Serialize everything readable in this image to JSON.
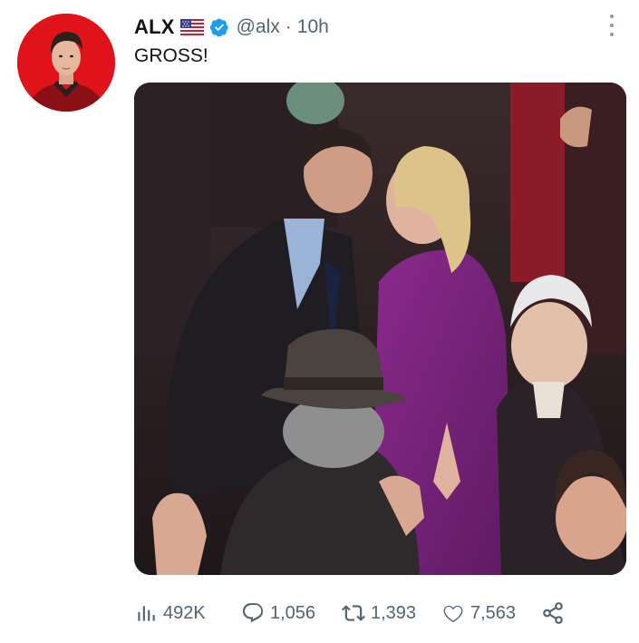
{
  "tweet": {
    "author": {
      "display_name": "ALX",
      "flag_icon": "us-flag-icon",
      "verified": true,
      "handle": "@alx"
    },
    "separator": "·",
    "time": "10h",
    "text": "GROSS!",
    "media": {
      "kind": "photo"
    },
    "metrics": {
      "views": "492K",
      "replies": "1,056",
      "retweets": "1,393",
      "likes": "7,563"
    }
  },
  "colors": {
    "text": "#0f1419",
    "secondary": "#536471",
    "verified_blue": "#1d9bf0",
    "avatar_bg": "#e0131b"
  }
}
